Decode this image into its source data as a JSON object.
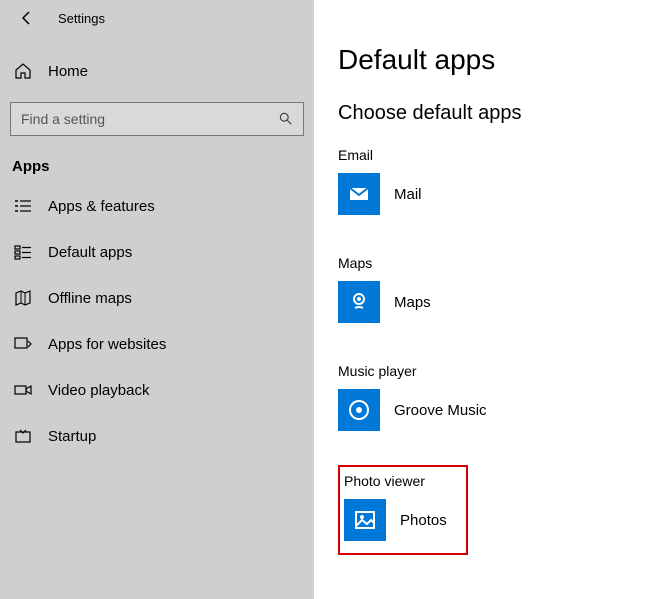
{
  "window": {
    "title": "Settings"
  },
  "sidebar": {
    "home_label": "Home",
    "search_placeholder": "Find a setting",
    "section_title": "Apps",
    "items": [
      {
        "label": "Apps & features"
      },
      {
        "label": "Default apps"
      },
      {
        "label": "Offline maps"
      },
      {
        "label": "Apps for websites"
      },
      {
        "label": "Video playback"
      },
      {
        "label": "Startup"
      }
    ]
  },
  "main": {
    "page_title": "Default apps",
    "sub_title": "Choose default apps",
    "categories": [
      {
        "label": "Email",
        "app_name": "Mail"
      },
      {
        "label": "Maps",
        "app_name": "Maps"
      },
      {
        "label": "Music player",
        "app_name": "Groove Music"
      },
      {
        "label": "Photo viewer",
        "app_name": "Photos"
      }
    ]
  }
}
